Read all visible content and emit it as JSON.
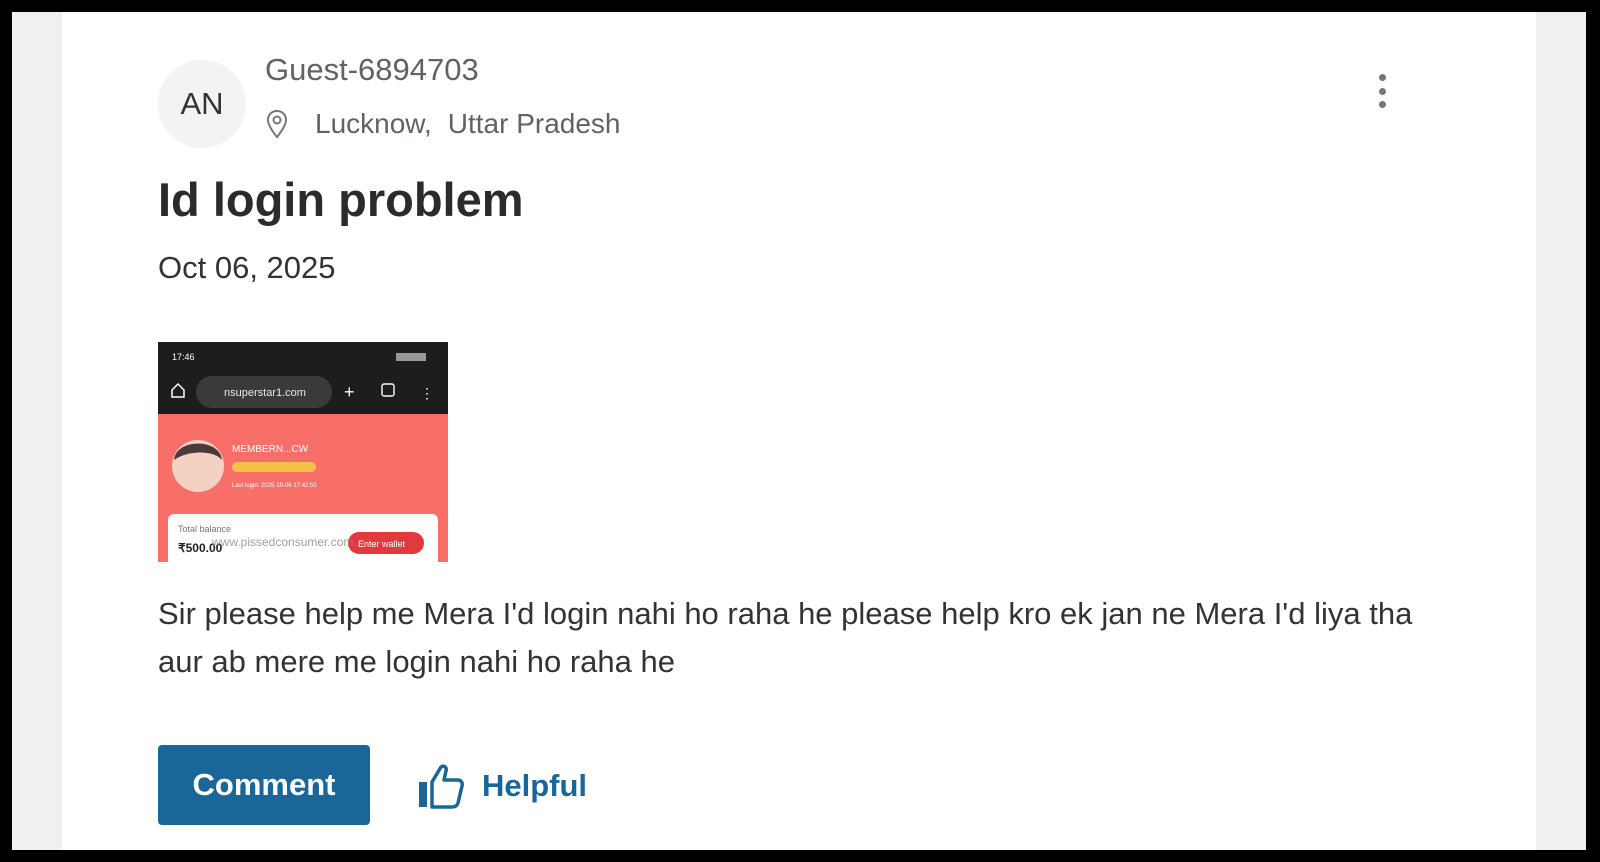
{
  "post": {
    "avatar_initials": "AN",
    "username": "Guest-6894703",
    "location": {
      "city": "Lucknow,",
      "state": "Uttar Pradesh"
    },
    "title": "Id login problem",
    "date": "Oct 06, 2025",
    "description": "Sir please help me Mera I'd login nahi ho raha he please help kro ek jan ne Mera I'd liya tha aur ab mere me login nahi ho raha he"
  },
  "attachment": {
    "status_time": "17:46",
    "url_text": "nsuperstar1.com",
    "member_label": "MEMBERN...CW",
    "last_login": "Last login: 2025-10-06 17:42:50",
    "balance_label": "Total balance",
    "balance_value": "₹500.00",
    "wallet_button": "Enter wallet",
    "watermark": "www.pissedconsumer.com"
  },
  "actions": {
    "comment_label": "Comment",
    "helpful_label": "Helpful"
  },
  "colors": {
    "accent": "#1b6698",
    "text_secondary": "#5f6368",
    "screenshot_header": "#1d1d1d",
    "screenshot_banner": "#f76f68"
  },
  "icons": [
    "location-pin-icon",
    "more-vertical-icon",
    "thumbs-up-icon"
  ]
}
